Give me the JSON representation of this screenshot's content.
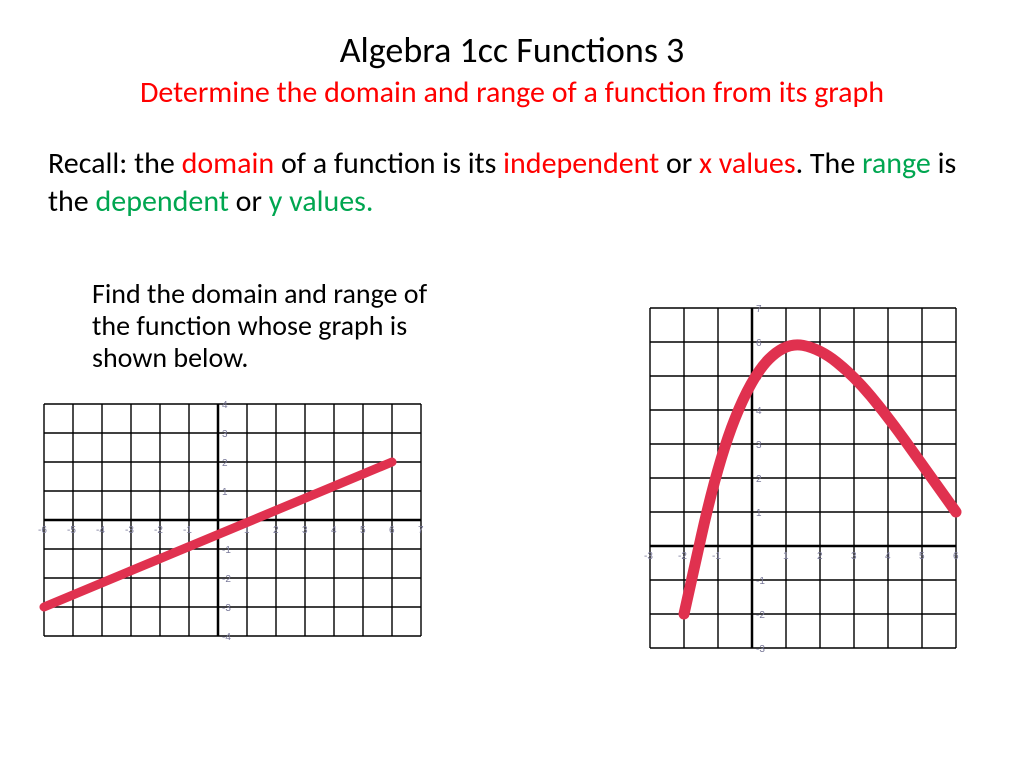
{
  "title": {
    "main": "Algebra 1cc  Functions 3",
    "sub": "Determine the domain and range of a function from its graph"
  },
  "recall": {
    "t1": "Recall: the ",
    "domain": "domain",
    "t2": " of a function is its ",
    "independent": "independent",
    "t3": " or ",
    "xvalues": "x values",
    "t4": ".  The ",
    "range": "range",
    "t5": " is the ",
    "dependent": "dependent",
    "t6": " or ",
    "yvalues": "y values."
  },
  "prompt": "Find the domain and range of the function whose graph is shown below.",
  "chart_data": [
    {
      "type": "line",
      "title": "",
      "xlabel": "",
      "ylabel": "",
      "xlim": [
        -6,
        7
      ],
      "ylim": [
        -4,
        4
      ],
      "x_ticks": [
        -6,
        -5,
        -4,
        -3,
        -2,
        -1,
        0,
        1,
        2,
        3,
        4,
        5,
        6,
        7
      ],
      "y_ticks": [
        -4,
        -3,
        -2,
        -1,
        1,
        2,
        3,
        4
      ],
      "series": [
        {
          "name": "line-segment",
          "points": [
            [
              -6,
              -3
            ],
            [
              6,
              2
            ]
          ]
        }
      ],
      "colors": {
        "curve": "#e0314f",
        "grid": "#000000",
        "ticks": "#7a7a9a"
      }
    },
    {
      "type": "line",
      "title": "",
      "xlabel": "",
      "ylabel": "",
      "xlim": [
        -3,
        6
      ],
      "ylim": [
        -3,
        7
      ],
      "x_ticks": [
        -3,
        -2,
        -1,
        0,
        1,
        2,
        3,
        4,
        5,
        6
      ],
      "y_ticks": [
        -3,
        -2,
        -1,
        1,
        2,
        3,
        4,
        5,
        6,
        7
      ],
      "series": [
        {
          "name": "parabola",
          "points": [
            [
              -2,
              -2
            ],
            [
              -1,
              2.5
            ],
            [
              0,
              5
            ],
            [
              1,
              6
            ],
            [
              2,
              5.8
            ],
            [
              3,
              5
            ],
            [
              4,
              3.8
            ],
            [
              5,
              2.4
            ],
            [
              6,
              1
            ]
          ]
        }
      ],
      "colors": {
        "curve": "#e0314f",
        "grid": "#000000",
        "ticks": "#7a7a9a"
      }
    }
  ]
}
